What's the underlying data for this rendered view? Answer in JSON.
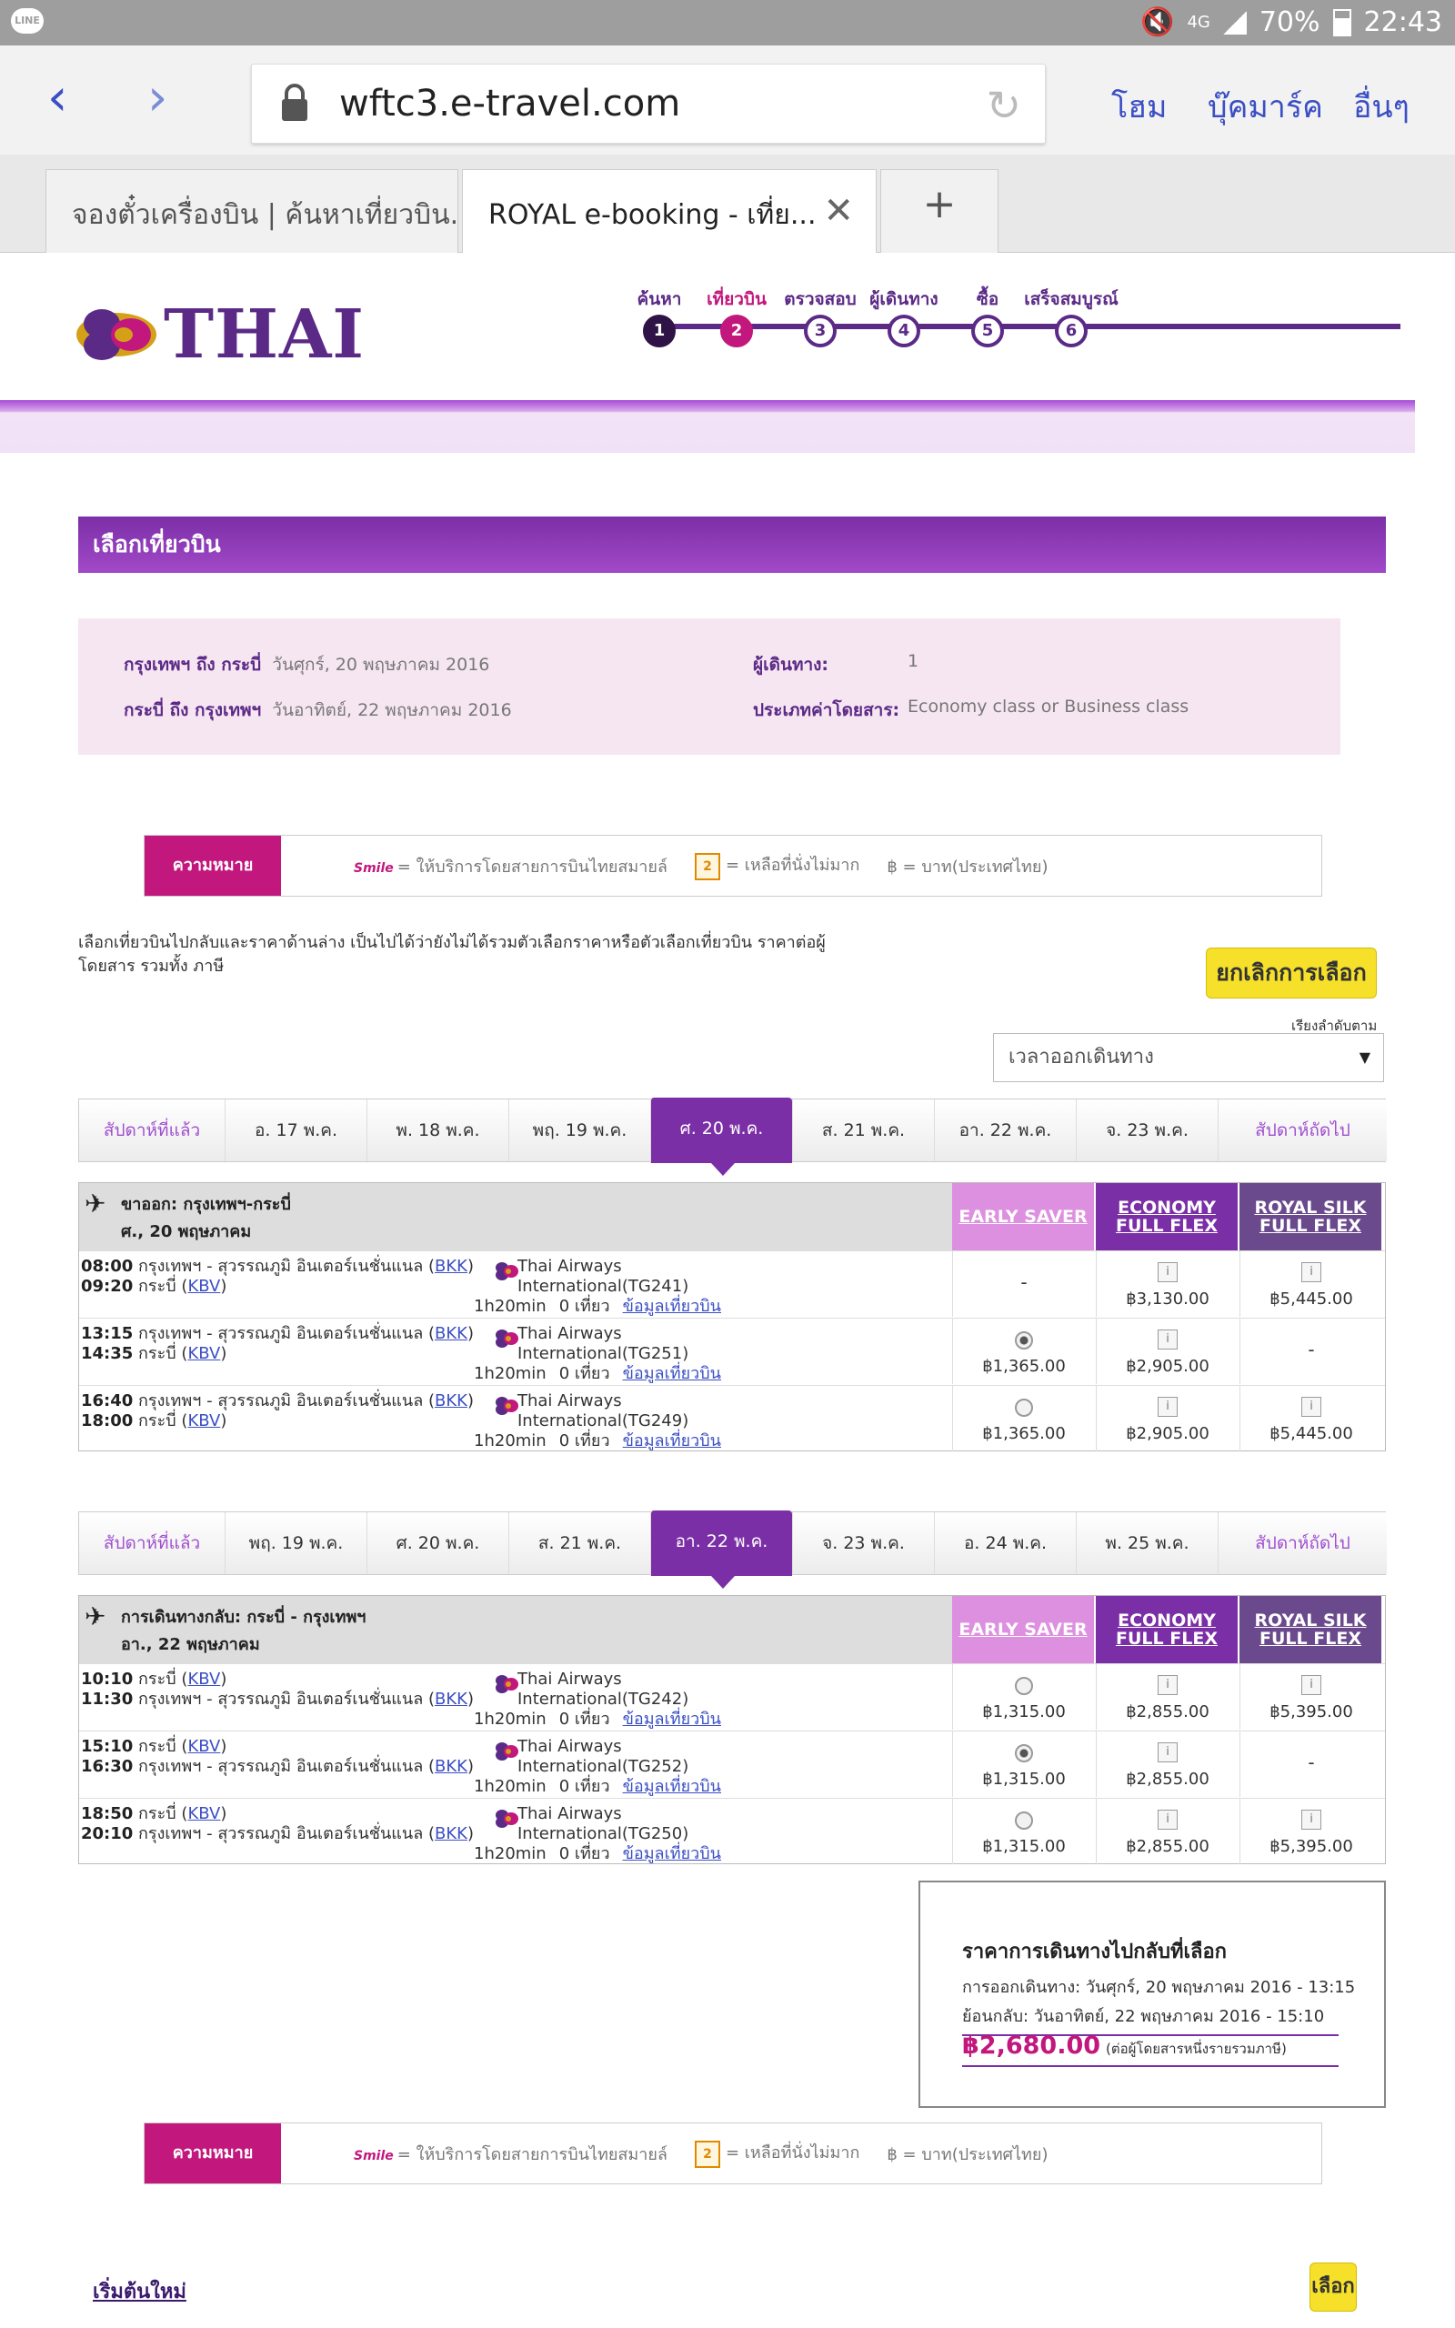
{
  "statusbar": {
    "line_icon": "LINE",
    "network": "4G",
    "battery": "70%",
    "time": "22:43"
  },
  "browser": {
    "url": "wftc3.e-travel.com",
    "links": [
      "โฮม",
      "บุ๊คมาร์ค",
      "อื่นๆ"
    ],
    "tabs": [
      {
        "title": "จองตั๋วเครื่องบิน | ค้นหาเที่ยวบิน..."
      },
      {
        "title": "ROYAL e-booking - เที่ย..."
      }
    ],
    "new_tab": "+"
  },
  "brand": {
    "logo_text": "THAI"
  },
  "steps": [
    {
      "label": "ค้นหา",
      "num": "1",
      "state": "done"
    },
    {
      "label": "เที่ยวบิน",
      "num": "2",
      "state": "current"
    },
    {
      "label": "ตรวจสอบ",
      "num": "3",
      "state": "todo"
    },
    {
      "label": "ผู้เดินทาง",
      "num": "4",
      "state": "todo"
    },
    {
      "label": "ซื้อ",
      "num": "5",
      "state": "todo"
    },
    {
      "label": "เสร็จสมบูรณ์",
      "num": "6",
      "state": "todo"
    }
  ],
  "page_title": "เลือกเที่ยวบิน",
  "summary": {
    "route1_label": "กรุงเทพฯ ถึง กระบี่",
    "route1_date": "วันศุกร์, 20 พฤษภาคม 2016",
    "route2_label": "กระบี่ ถึง กรุงเทพฯ",
    "route2_date": "วันอาทิตย์, 22 พฤษภาคม 2016",
    "pax_label": "ผู้เดินทาง:",
    "pax_value": "1",
    "fare_label": "ประเภทค่าโดยสาร:",
    "fare_value": "Economy class or Business class"
  },
  "legend": {
    "key": "ความหมาย",
    "smile_icon": "Smile",
    "smile_text": "= ให้บริการโดยสายการบินไทยสมายล์",
    "seats_icon": "2",
    "seats_text": "= เหลือที่นั่งไม่มาก",
    "baht_text": "฿ = บาท(ประเทศไทย)"
  },
  "instructions": "เลือกเที่ยวบินไปกลับและราคาด้านล่าง เป็นไปได้ว่ายังไม่ได้รวมตัวเลือกราคาหรือตัวเลือกเที่ยวบิน ราคาต่อผู้โดยสาร รวมทั้ง ภาษี",
  "cancel_button": "ยกเลิกการเลือก",
  "sort": {
    "label": "เรียงลำดับตาม",
    "value": "เวลาออกเดินทาง"
  },
  "fare_columns": [
    "EARLY SAVER",
    "ECONOMY FULL FLEX",
    "ROYAL SILK FULL FLEX"
  ],
  "outbound": {
    "prev_week": "สัปดาห์ที่แล้ว",
    "next_week": "สัปดาห์ถัดไป",
    "dates": [
      "อ. 17 พ.ค.",
      "พ. 18 พ.ค.",
      "พฤ. 19 พ.ค.",
      "ศ. 20 พ.ค.",
      "ส. 21 พ.ค.",
      "อา. 22 พ.ค.",
      "จ. 23 พ.ค."
    ],
    "selected_index": 3,
    "title": "ขาออก: กรุงเทพฯ-กระบี่",
    "date": "ศ., 20 พฤษภาคม",
    "flights": [
      {
        "dep": "08:00",
        "dep_place": "กรุงเทพฯ - สุวรรณภูมิ อินเตอร์เนชั่นแนล (",
        "dep_code": "BKK",
        "arr": "09:20",
        "arr_place": "กระบี่ (",
        "arr_code": "KBV",
        "airline1": "Thai Airways",
        "airline2": "International(TG241)",
        "duration": "1h20min",
        "stops": "0 เที่ยว",
        "details": "ข้อมูลเที่ยวบิน",
        "fares": [
          {
            "kind": "dash",
            "price": "-"
          },
          {
            "kind": "info",
            "price": "฿3,130.00"
          },
          {
            "kind": "info",
            "price": "฿5,445.00"
          }
        ]
      },
      {
        "dep": "13:15",
        "dep_place": "กรุงเทพฯ - สุวรรณภูมิ อินเตอร์เนชั่นแนล (",
        "dep_code": "BKK",
        "arr": "14:35",
        "arr_place": "กระบี่ (",
        "arr_code": "KBV",
        "airline1": "Thai Airways",
        "airline2": "International(TG251)",
        "duration": "1h20min",
        "stops": "0 เที่ยว",
        "details": "ข้อมูลเที่ยวบิน",
        "fares": [
          {
            "kind": "radio-on",
            "price": "฿1,365.00"
          },
          {
            "kind": "info",
            "price": "฿2,905.00"
          },
          {
            "kind": "dash",
            "price": "-"
          }
        ]
      },
      {
        "dep": "16:40",
        "dep_place": "กรุงเทพฯ - สุวรรณภูมิ อินเตอร์เนชั่นแนล (",
        "dep_code": "BKK",
        "arr": "18:00",
        "arr_place": "กระบี่ (",
        "arr_code": "KBV",
        "airline1": "Thai Airways",
        "airline2": "International(TG249)",
        "duration": "1h20min",
        "stops": "0 เที่ยว",
        "details": "ข้อมูลเที่ยวบิน",
        "fares": [
          {
            "kind": "radio",
            "price": "฿1,365.00"
          },
          {
            "kind": "info",
            "price": "฿2,905.00"
          },
          {
            "kind": "info",
            "price": "฿5,445.00"
          }
        ]
      }
    ]
  },
  "inbound": {
    "prev_week": "สัปดาห์ที่แล้ว",
    "next_week": "สัปดาห์ถัดไป",
    "dates": [
      "พฤ. 19 พ.ค.",
      "ศ. 20 พ.ค.",
      "ส. 21 พ.ค.",
      "อา. 22 พ.ค.",
      "จ. 23 พ.ค.",
      "อ. 24 พ.ค.",
      "พ. 25 พ.ค."
    ],
    "selected_index": 3,
    "title": "การเดินทางกลับ: กระบี่ - กรุงเทพฯ",
    "date": "อา., 22 พฤษภาคม",
    "flights": [
      {
        "dep": "10:10",
        "dep_place": "กระบี่ (",
        "dep_code": "KBV",
        "arr": "11:30",
        "arr_place": "กรุงเทพฯ - สุวรรณภูมิ อินเตอร์เนชั่นแนล (",
        "arr_code": "BKK",
        "airline1": "Thai Airways",
        "airline2": "International(TG242)",
        "duration": "1h20min",
        "stops": "0 เที่ยว",
        "details": "ข้อมูลเที่ยวบิน",
        "fares": [
          {
            "kind": "radio",
            "price": "฿1,315.00"
          },
          {
            "kind": "info",
            "price": "฿2,855.00"
          },
          {
            "kind": "info",
            "price": "฿5,395.00"
          }
        ]
      },
      {
        "dep": "15:10",
        "dep_place": "กระบี่ (",
        "dep_code": "KBV",
        "arr": "16:30",
        "arr_place": "กรุงเทพฯ - สุวรรณภูมิ อินเตอร์เนชั่นแนล (",
        "arr_code": "BKK",
        "airline1": "Thai Airways",
        "airline2": "International(TG252)",
        "duration": "1h20min",
        "stops": "0 เที่ยว",
        "details": "ข้อมูลเที่ยวบิน",
        "fares": [
          {
            "kind": "radio-on",
            "price": "฿1,315.00"
          },
          {
            "kind": "info",
            "price": "฿2,855.00"
          },
          {
            "kind": "dash",
            "price": "-"
          }
        ]
      },
      {
        "dep": "18:50",
        "dep_place": "กระบี่ (",
        "dep_code": "KBV",
        "arr": "20:10",
        "arr_place": "กรุงเทพฯ - สุวรรณภูมิ อินเตอร์เนชั่นแนล (",
        "arr_code": "BKK",
        "airline1": "Thai Airways",
        "airline2": "International(TG250)",
        "duration": "1h20min",
        "stops": "0 เที่ยว",
        "details": "ข้อมูลเที่ยวบิน",
        "fares": [
          {
            "kind": "radio",
            "price": "฿1,315.00"
          },
          {
            "kind": "info",
            "price": "฿2,855.00"
          },
          {
            "kind": "info",
            "price": "฿5,395.00"
          }
        ]
      }
    ]
  },
  "price_summary": {
    "title": "ราคาการเดินทางไปกลับที่เลือก",
    "depart": "การออกเดินทาง: วันศุกร์, 20 พฤษภาคม 2016 - 13:15",
    "return": "ย้อนกลับ: วันอาทิตย์, 22 พฤษภาคม 2016 - 15:10",
    "total": "฿2,680.00",
    "note": "(ต่อผู้โดยสารหนึ่งรายรวมภาษี)"
  },
  "restart_link": "เริ่มต้นใหม่",
  "select_button": "เลือก",
  "colors": {
    "purple": "#7b2fa6",
    "magenta": "#c2177d",
    "early_saver": "#dd8fe0",
    "royal_silk": "#6a4a8c",
    "yellow": "#f6e02a",
    "link": "#3b4fc4"
  },
  "icons": [
    "line-app-icon",
    "mute-icon",
    "signal-icon",
    "battery-icon",
    "back-icon",
    "forward-icon",
    "lock-icon",
    "reload-icon",
    "close-icon",
    "plus-icon",
    "plane-icon",
    "radio-icon",
    "info-icon",
    "thai-orchid-logo"
  ]
}
